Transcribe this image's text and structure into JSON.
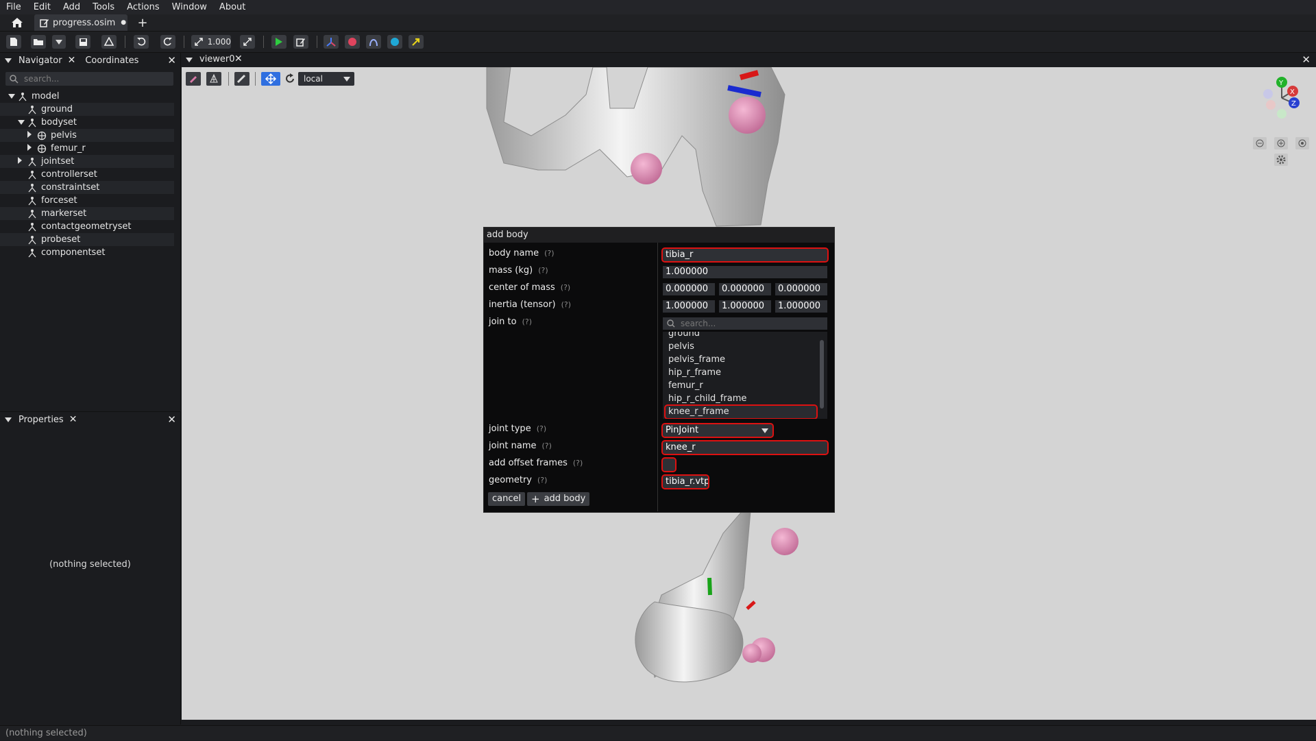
{
  "menu": [
    "File",
    "Edit",
    "Add",
    "Tools",
    "Actions",
    "Window",
    "About"
  ],
  "tab": {
    "title": "progress.osim",
    "modified_marker": "●",
    "new_tab": "+"
  },
  "toolbar": {
    "zoom_value": "1.000",
    "colors": {
      "play": "#2ecc40",
      "red": "#e0445e",
      "blue": "#1fa8d6",
      "yellow": "#e6d21a"
    }
  },
  "navigator": {
    "tab1": "Navigator",
    "tab2": "Coordinates",
    "search_placeholder": "search...",
    "items": [
      {
        "label": "model",
        "level": 0,
        "expander": "down"
      },
      {
        "label": "ground",
        "level": 1,
        "expander": "none"
      },
      {
        "label": "bodyset",
        "level": 1,
        "expander": "down"
      },
      {
        "label": "pelvis",
        "level": 2,
        "expander": "right"
      },
      {
        "label": "femur_r",
        "level": 2,
        "expander": "right"
      },
      {
        "label": "jointset",
        "level": 1,
        "expander": "right"
      },
      {
        "label": "controllerset",
        "level": 1,
        "expander": "none"
      },
      {
        "label": "constraintset",
        "level": 1,
        "expander": "none"
      },
      {
        "label": "forceset",
        "level": 1,
        "expander": "none"
      },
      {
        "label": "markerset",
        "level": 1,
        "expander": "none"
      },
      {
        "label": "contactgeometryset",
        "level": 1,
        "expander": "none"
      },
      {
        "label": "probeset",
        "level": 1,
        "expander": "none"
      },
      {
        "label": "componentset",
        "level": 1,
        "expander": "none"
      }
    ]
  },
  "properties": {
    "title": "Properties",
    "empty": "(nothing selected)"
  },
  "viewer": {
    "tab": "viewer0",
    "frame_mode": "local"
  },
  "dialog": {
    "title": "add body",
    "help": "(?)",
    "labels": {
      "body_name": "body name",
      "mass": "mass (kg)",
      "com": "center of mass",
      "inertia": "inertia (tensor)",
      "join_to": "join to",
      "joint_type": "joint type",
      "joint_name": "joint name",
      "offset": "add offset frames",
      "geometry": "geometry"
    },
    "values": {
      "body_name": "tibia_r",
      "mass": "1.000000",
      "com": [
        "0.000000",
        "0.000000",
        "0.000000"
      ],
      "inertia": [
        "1.000000",
        "1.000000",
        "1.000000"
      ],
      "join_search_placeholder": "search...",
      "join_list": [
        "ground",
        "pelvis",
        "pelvis_frame",
        "hip_r_frame",
        "femur_r",
        "hip_r_child_frame",
        "knee_r_frame"
      ],
      "joint_type": "PinJoint",
      "joint_name": "knee_r",
      "geometry": "tibia_r.vtp"
    },
    "buttons": {
      "cancel": "cancel",
      "add": "add body"
    }
  },
  "status": "(nothing selected)"
}
